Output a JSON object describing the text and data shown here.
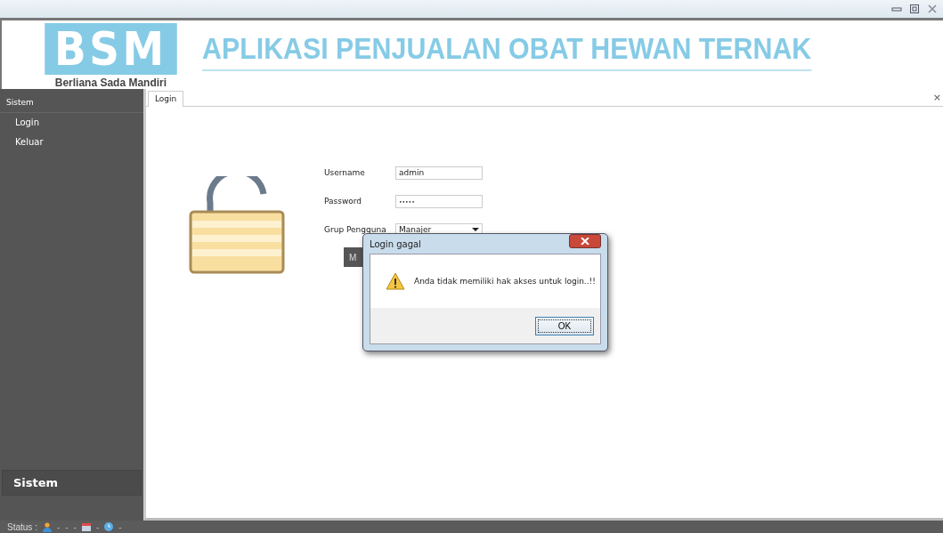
{
  "header": {
    "logo": "BSM",
    "company": "Berliana Sada Mandiri",
    "title": "APLIKASI PENJUALAN OBAT HEWAN TERNAK"
  },
  "sidebar": {
    "group": "Sistem",
    "items": [
      {
        "label": "Login"
      },
      {
        "label": "Keluar"
      }
    ],
    "footer_group": "Sistem"
  },
  "tabs": [
    {
      "label": "Login",
      "selected": true
    }
  ],
  "tab_close": "×",
  "form": {
    "fields": [
      {
        "label": "Username",
        "value": "admin",
        "kind": "text"
      },
      {
        "label": "Password",
        "value": "•••••",
        "kind": "password"
      },
      {
        "label": "Grup Pengguna",
        "value": "Manajer",
        "kind": "select"
      }
    ],
    "button": "M"
  },
  "dialog": {
    "title": "Login gagal",
    "message": "Anda tidak memiliki hak akses untuk login..!!",
    "button": "OK"
  },
  "status_bar": {
    "label": "Status :",
    "items": [
      {
        "kind": "user",
        "text": "-"
      },
      {
        "kind": "plain",
        "text": "-"
      },
      {
        "kind": "plain",
        "text": "-"
      },
      {
        "kind": "calendar",
        "text": "-"
      },
      {
        "kind": "clock",
        "text": "-"
      }
    ]
  }
}
